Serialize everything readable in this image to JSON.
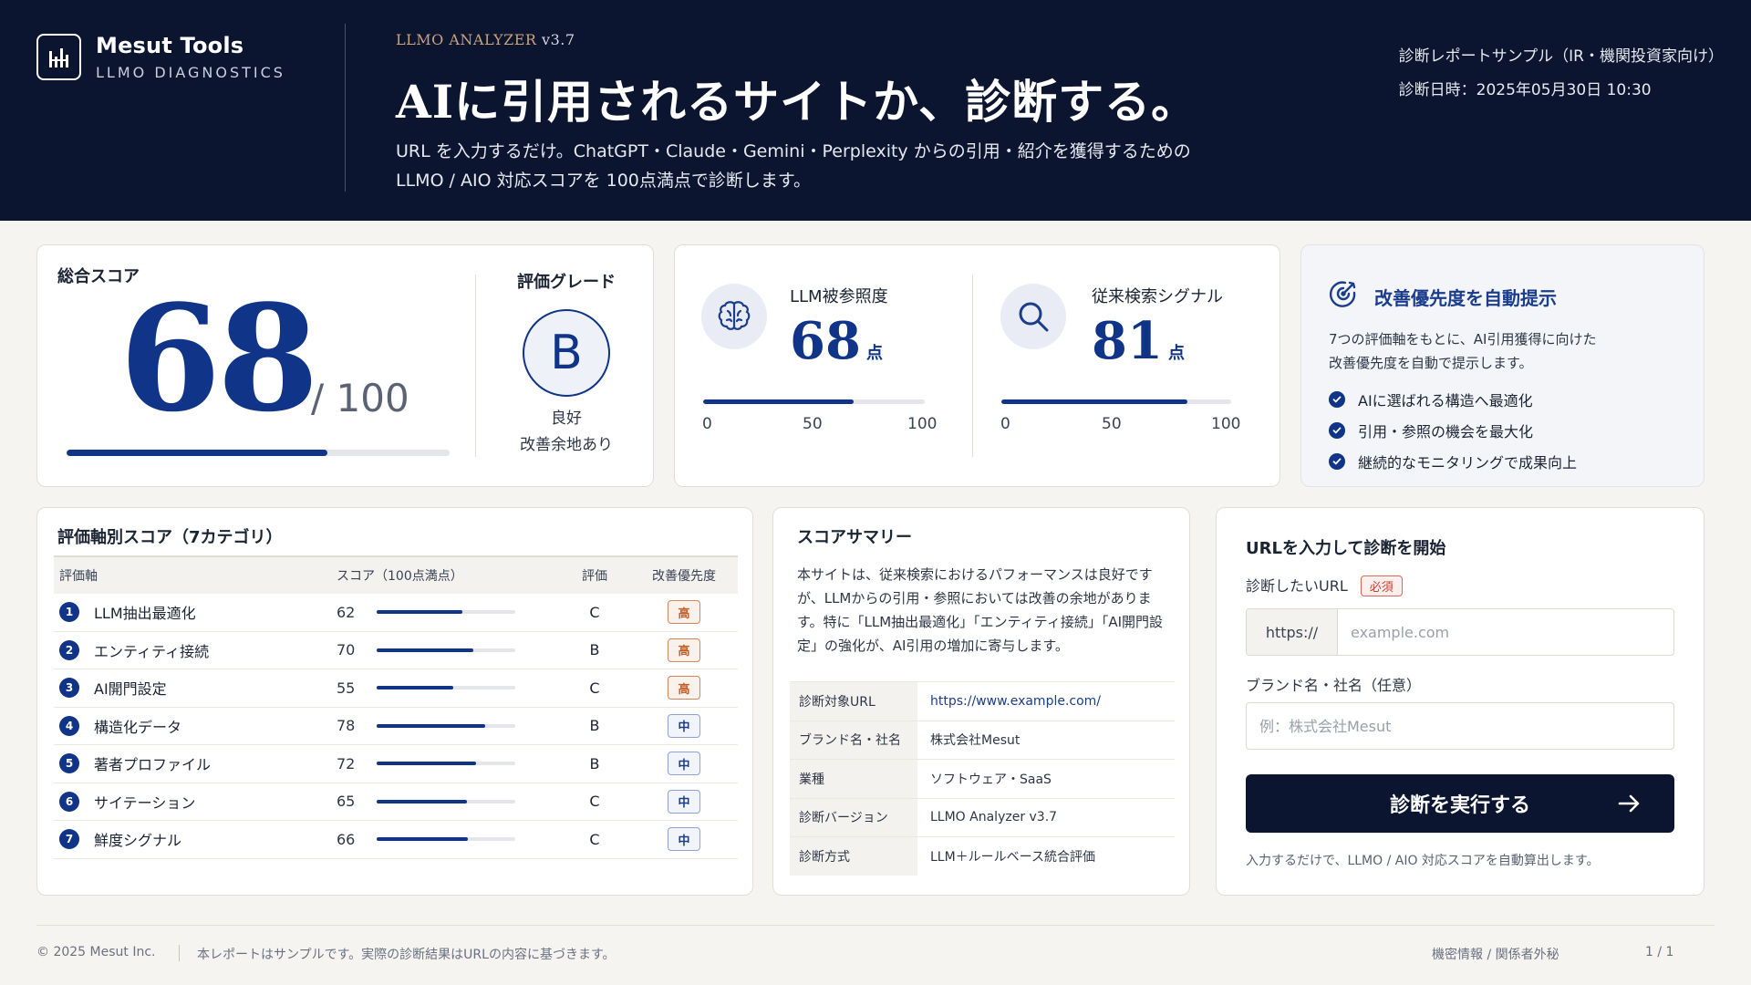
{
  "brand": {
    "name": "Mesut Tools",
    "sub": "LLMO DIAGNOSTICS",
    "logo_icon": "bar-chart-logo-icon"
  },
  "header": {
    "analyzer_name": "LLMO ANALYZER",
    "analyzer_version": "v3.7",
    "headline": "AIに引用されるサイトか、診断する。",
    "lead_line1": "URL を入力するだけ。ChatGPT・Claude・Gemini・Perplexity からの引用・紹介を獲得するための",
    "lead_line2": "LLMO / AIO 対応スコアを 100点満点で診断します。",
    "report_type": "診断レポートサンプル（IR・機関投資家向け）",
    "report_datetime": "診断日時：2025年05月30日 10:30"
  },
  "total": {
    "label": "総合スコア",
    "score": "68",
    "score_value": 68,
    "max": "/ 100",
    "grade_label": "評価グレード",
    "grade": "B",
    "grade_desc1": "良好",
    "grade_desc2": "改善余地あり"
  },
  "subscores": [
    {
      "label": "LLM被参照度",
      "value": "68",
      "value_num": 68,
      "unit": "点",
      "icon": "brain-icon",
      "axis": [
        "0",
        "50",
        "100"
      ]
    },
    {
      "label": "従来検索シグナル",
      "value": "81",
      "value_num": 81,
      "unit": "点",
      "icon": "search-icon",
      "axis": [
        "0",
        "50",
        "100"
      ]
    }
  ],
  "improve": {
    "title": "改善優先度を自動提示",
    "icon": "target-icon",
    "desc1": "7つの評価軸をもとに、AI引用獲得に向けた",
    "desc2": "改善優先度を自動で提示します。",
    "items": [
      "AIに選ばれる構造へ最適化",
      "引用・参照の機会を最大化",
      "継続的なモニタリングで成果向上"
    ]
  },
  "categories": {
    "title": "評価軸別スコア（7カテゴリ）",
    "headers": {
      "name": "評価軸",
      "score": "スコア（100点満点）",
      "grade": "評価",
      "priority": "改善優先度"
    },
    "rows": [
      {
        "num": "1",
        "name": "LLM抽出最適化",
        "score": "62",
        "value": 62,
        "grade": "C",
        "priority": "高",
        "level": "high"
      },
      {
        "num": "2",
        "name": "エンティティ接続",
        "score": "70",
        "value": 70,
        "grade": "B",
        "priority": "高",
        "level": "high"
      },
      {
        "num": "3",
        "name": "AI開門設定",
        "score": "55",
        "value": 55,
        "grade": "C",
        "priority": "高",
        "level": "high"
      },
      {
        "num": "4",
        "name": "構造化データ",
        "score": "78",
        "value": 78,
        "grade": "B",
        "priority": "中",
        "level": "mid"
      },
      {
        "num": "5",
        "name": "著者プロファイル",
        "score": "72",
        "value": 72,
        "grade": "B",
        "priority": "中",
        "level": "mid"
      },
      {
        "num": "6",
        "name": "サイテーション",
        "score": "65",
        "value": 65,
        "grade": "C",
        "priority": "中",
        "level": "mid"
      },
      {
        "num": "7",
        "name": "鮮度シグナル",
        "score": "66",
        "value": 66,
        "grade": "C",
        "priority": "中",
        "level": "mid"
      }
    ]
  },
  "summary": {
    "title": "スコアサマリー",
    "text": "本サイトは、従来検索におけるパフォーマンスは良好ですが、LLMからの引用・参照においては改善の余地があります。特に「LLM抽出最適化」「エンティティ接続」「AI開門設定」の強化が、AI引用の増加に寄与します。",
    "rows": [
      {
        "key": "診断対象URL",
        "value": "https://www.example.com/",
        "link": true
      },
      {
        "key": "ブランド名・社名",
        "value": "株式会社Mesut",
        "link": false
      },
      {
        "key": "業種",
        "value": "ソフトウェア・SaaS",
        "link": false
      },
      {
        "key": "診断バージョン",
        "value": "LLMO Analyzer v3.7",
        "link": false
      },
      {
        "key": "診断方式",
        "value": "LLM＋ルールベース統合評価",
        "link": false
      }
    ]
  },
  "form": {
    "title": "URLを入力して診断を開始",
    "url_label": "診断したいURL",
    "required": "必須",
    "url_prefix": "https://",
    "url_placeholder": "example.com",
    "brand_label": "ブランド名・社名（任意）",
    "brand_placeholder": "例：株式会社Mesut",
    "button": "診断を実行する",
    "note": "入力するだけで、LLMO / AIO 対応スコアを自動算出します。"
  },
  "footer": {
    "copyright": "© 2025 Mesut Inc.",
    "disclaimer": "本レポートはサンプルです。実際の診断結果はURLの内容に基づきます。",
    "confidential": "機密情報 / 関係者外秘",
    "page": "1 / 1"
  },
  "colors": {
    "navy": "#0b1530",
    "accent": "#0f3488",
    "high": "#c0602b",
    "mid": "#1b3d8c"
  }
}
